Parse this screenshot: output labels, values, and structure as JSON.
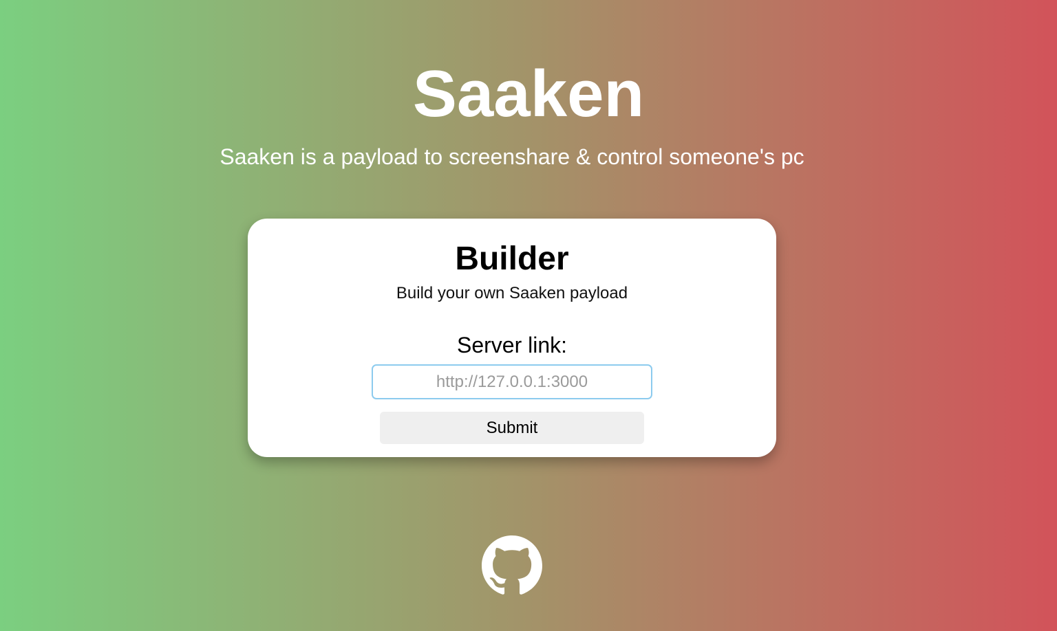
{
  "header": {
    "title": "Saaken",
    "subtitle": "Saaken is a payload to screenshare & control someone's pc"
  },
  "builder": {
    "title": "Builder",
    "subtitle": "Build your own Saaken payload",
    "server_label": "Server link:",
    "server_input": {
      "value": "",
      "placeholder": "http://127.0.0.1:3000"
    },
    "submit_label": "Submit"
  },
  "footer": {
    "github_icon": "github-icon"
  },
  "colors": {
    "gradient_start": "#7bcf80",
    "gradient_middle": "#a39369",
    "gradient_end": "#d2535a",
    "card_background": "#ffffff",
    "input_border": "#8ccbee",
    "button_background": "#efefef"
  }
}
